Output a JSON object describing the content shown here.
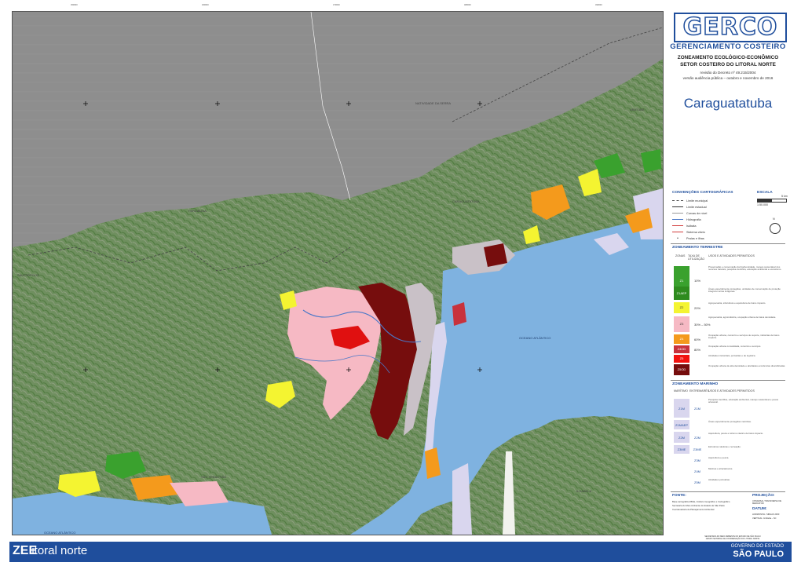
{
  "header": {
    "logo": "GERCO",
    "subtitle": "GERENCIAMENTO COSTEIRO",
    "title1": "ZONEAMENTO ECOLÓGICO-ECONÔMICO",
    "title2": "SETOR COSTEIRO DO LITORAL NORTE",
    "decree": "revisão do Decreto nº 49.215/2004",
    "version": "versão audiência pública – outubro e novembro de 2016",
    "municipality": "Caraguatatuba"
  },
  "map_labels": {
    "natividade": "NATIVIDADE DA SERRA",
    "ubatuba": "UBATUBA",
    "paraibuna": "PARAIBUNA",
    "salesopolis": "SALESÓPOLIS",
    "caraguatatuba": "CARAGUATATUBA",
    "sao_sebastiao": "SÃO SEBASTIÃO",
    "oceano1": "OCEANO ATLÂNTICO",
    "oceano2": "OCEANO ATLÂNTICO",
    "ilhabela": "ILHABELA"
  },
  "legend": {
    "conventions_title": "CONVENÇÕES CARTOGRÁFICAS",
    "scale_title": "ESCALA",
    "scale_km": "5 km",
    "scale_ratio": "1:50.000",
    "items": [
      {
        "label": "Limite municipal",
        "color": "#555555"
      },
      {
        "label": "Limite estadual",
        "color": "#333333"
      },
      {
        "label": "Curvas de nível",
        "color": "#999999"
      },
      {
        "label": "Hidrografia",
        "color": "#4a78c8"
      },
      {
        "label": "Sistema viário",
        "color": "#d23c3c"
      },
      {
        "label": "Praias e ilhas",
        "color": "#c9a060"
      }
    ],
    "extra_item": "Sistema viário",
    "isobath_label": "Isóbata",
    "north_label": "N"
  },
  "terrestrial": {
    "title": "ZONEAMENTO TERRESTRE",
    "col_zone": "ZONAS",
    "col_rate": "TAXA DE UTILIZAÇÃO",
    "col_uses": "USOS E ATIVIDADES PERMITIDOS",
    "zones": [
      {
        "code": "Z1",
        "rate": "10%",
        "color": "#3aa12e",
        "text": "#fff",
        "desc": "Preservação e conservação da biodiversidade, manejo sustentável dos recursos naturais, pesquisa científica, educação ambiental e ecoturismo."
      },
      {
        "code": "Z1AEP",
        "rate": "",
        "color": "#2e8b1e",
        "text": "#fff",
        "desc": "Áreas especialmente protegidas, unidades de conservação de proteção integral e terras indígenas."
      },
      {
        "code": "Z2",
        "rate": "20%",
        "color": "#f4f431",
        "text": "#333",
        "desc": "Agropecuária, silvicultura e aquicultura de baixo impacto."
      },
      {
        "code": "Z3",
        "rate": "30% – 50%",
        "color": "#f6b9c4",
        "text": "#333",
        "desc": "Agropecuária, agroindústria, ocupação urbana de baixa densidade."
      },
      {
        "code": "Z4",
        "rate": "60%",
        "color": "#f49a1c",
        "text": "#fff",
        "desc": "Ocupação urbana, comércio e serviços de suporte, indústrias de baixo impacto."
      },
      {
        "code": "Z4OD",
        "rate": "80%",
        "color": "#c8323c",
        "text": "#fff",
        "desc": "Ocupação urbana consolidada, comércio e serviços."
      },
      {
        "code": "Z5",
        "rate": "",
        "color": "#f2120f",
        "text": "#fff",
        "desc": "Atividades industriais, portuárias e de logística."
      },
      {
        "code": "Z5OD",
        "rate": "",
        "color": "#760d0d",
        "text": "#fff",
        "desc": "Ocupação urbana de alta densidade e atividades econômicas diversificadas."
      }
    ]
  },
  "marine": {
    "title": "ZONEAMENTO MARINHO",
    "col_zone": "MARÍTIMO",
    "col_sub": "ENTREMARÉS",
    "col_uses": "USOS E ATIVIDADES PERMITIDOS",
    "zones": [
      {
        "code": "Z1M",
        "sub": "Z1M",
        "desc": "Pesquisa científica, educação ambiental, manejo sustentável e pesca artesanal."
      },
      {
        "code": "Z1MAEP",
        "sub": "",
        "desc": "Áreas especialmente protegidas marinhas."
      },
      {
        "code": "Z2M",
        "sub": "Z2M",
        "desc": "Aquicultura, pesca e turismo náutico de baixo impacto."
      },
      {
        "code": "Z3ME",
        "sub": "Z3ME",
        "desc": "Estruturas náuticas e recreação."
      },
      {
        "code": "",
        "sub": "Z3M",
        "desc": "Aquicultura e pesca."
      },
      {
        "code": "",
        "sub": "Z4M",
        "desc": "Marinas e atracadouros."
      },
      {
        "code": "",
        "sub": "Z5M",
        "desc": "Atividades portuárias."
      }
    ]
  },
  "source": {
    "title": "FONTE:",
    "lines": [
      "Base cartográfica IBGE, Instituto Geográfico e Cartográfico",
      "Secretaria do Meio Ambiente do Estado de São Paulo",
      "Coordenadoria de Planejamento Ambiental"
    ]
  },
  "projection": {
    "title": "PROJEÇÃO:",
    "lines": [
      "UNIVERSAL TRANSVERSA DE MERCATOR"
    ],
    "datum_title": "DATUM:",
    "datum_lines": [
      "HORIZONTAL: SIRGAS 2000",
      "VERTICAL: Imbituba – SC"
    ]
  },
  "credit": {
    "line1": "SECRETARIA DO MEIO AMBIENTE DO ESTADO DE SÃO PAULO",
    "line2": "GRUPO SETORIAL DE COORDENAÇÃO DO LITORAL NORTE"
  },
  "footer": {
    "zee": "ZEE",
    "region": "litoral norte",
    "gov1": "GOVERNO DO ESTADO",
    "gov2": "SÃO PAULO"
  },
  "colors": {
    "relief": "#8c8c8c",
    "forest": "#5b8a4b",
    "ocean": "#7fb2e0",
    "urban_dark": "#760d0d",
    "marine_lilac": "#d9d6ee"
  }
}
